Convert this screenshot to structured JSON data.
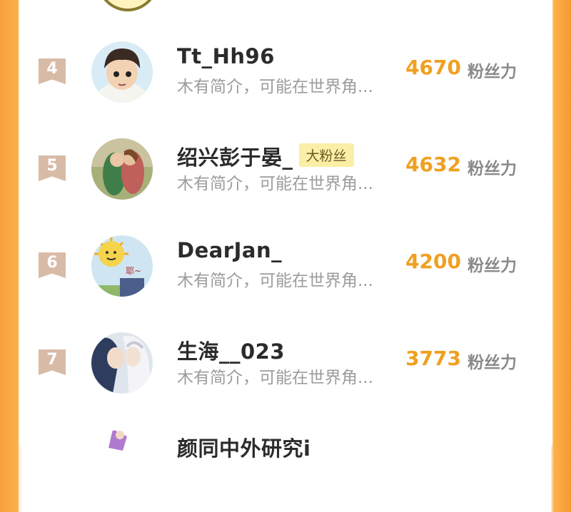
{
  "fans_suffix": "粉丝力",
  "badge_text": "大粉丝",
  "rows": [
    {
      "rank": "4",
      "name": "Tt_Hh96",
      "bio": "木有简介，可能在世界角...",
      "fans": "4670"
    },
    {
      "rank": "5",
      "name": "绍兴彭于晏_",
      "bio": "木有简介，可能在世界角...",
      "fans": "4632"
    },
    {
      "rank": "6",
      "name": "DearJan_",
      "bio": "木有简介，可能在世界角...",
      "fans": "4200"
    },
    {
      "rank": "7",
      "name": "生海__023",
      "bio": "木有简介，可能在世界角...",
      "fans": "3773"
    },
    {
      "name": "颜同中外研究i"
    }
  ]
}
